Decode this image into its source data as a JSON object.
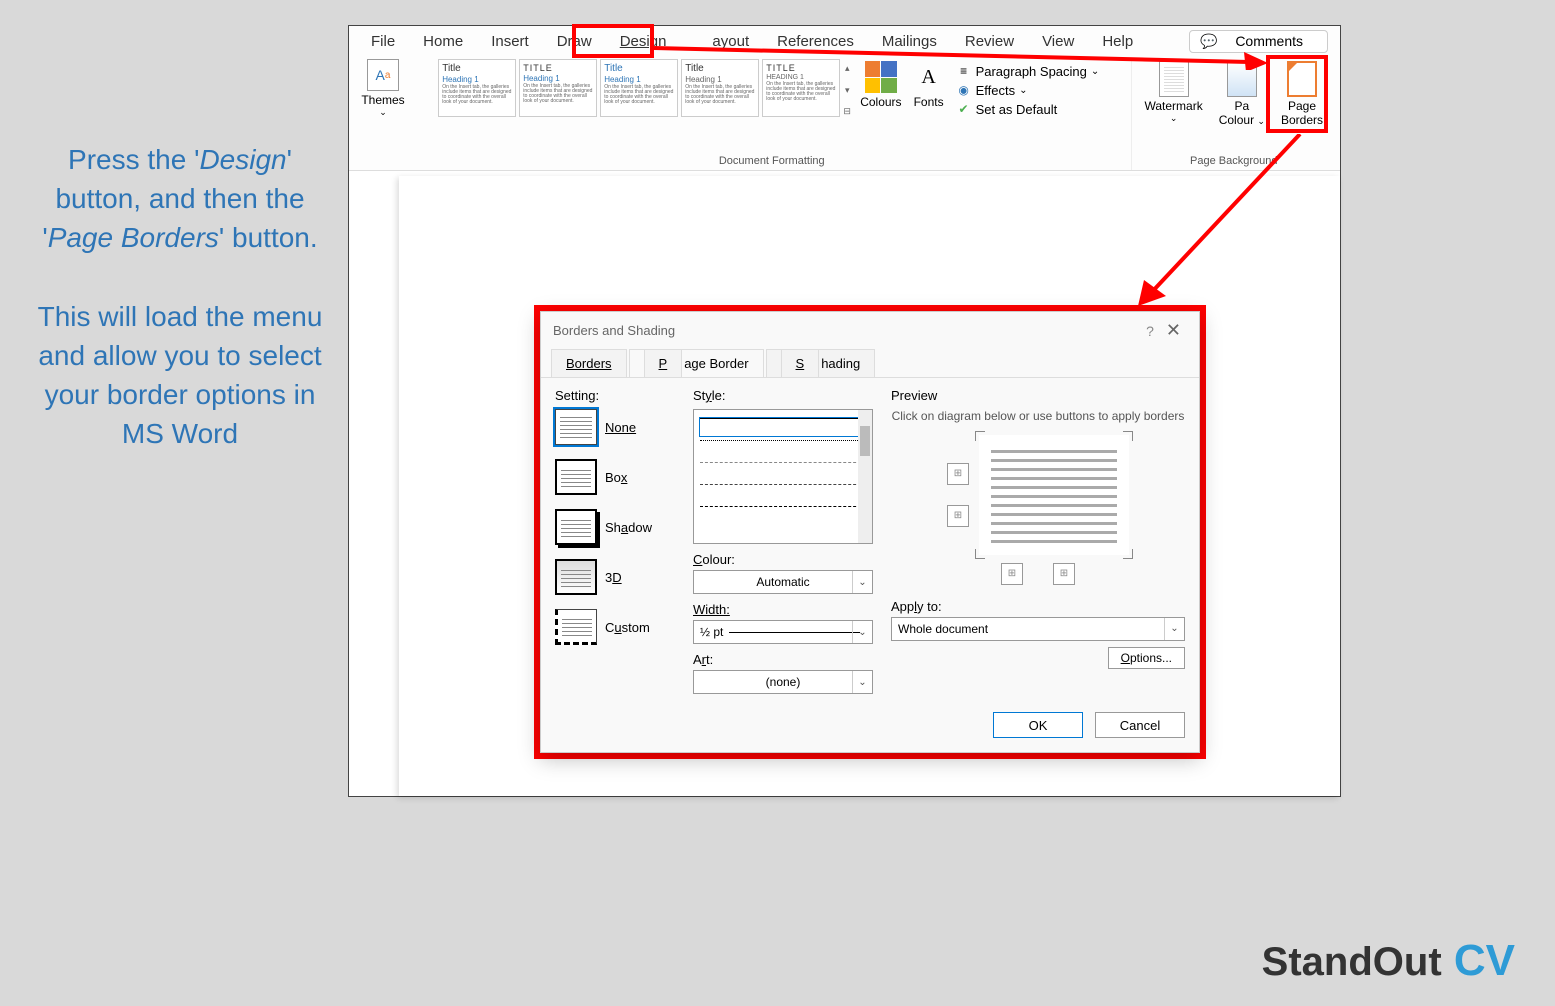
{
  "instruction": {
    "p1_prefix": "Press the '",
    "p1_em1": "Design",
    "p1_mid": "' button, and then the '",
    "p1_em2": "Page Borders",
    "p1_suffix": "' button.",
    "p2": "This will load the menu and allow you to select your border options in MS Word"
  },
  "ribbon": {
    "tabs": [
      "File",
      "Home",
      "Insert",
      "Draw",
      "Design",
      "ayout",
      "References",
      "Mailings",
      "Review",
      "View",
      "Help"
    ],
    "comments": "Comments",
    "themes": "Themes",
    "gallery_items": [
      {
        "title": "Title",
        "h": "Heading 1"
      },
      {
        "title": "TITLE",
        "h": "Heading 1"
      },
      {
        "title": "Title",
        "h": "Heading 1"
      },
      {
        "title": "Title",
        "h": "Heading 1"
      },
      {
        "title": "TITLE",
        "h": "HEADING 1"
      }
    ],
    "gallery_filler": "On the Insert tab, the galleries include items that are designed to coordinate with the overall look of your document.",
    "colours": "Colours",
    "fonts": "Fonts",
    "paragraph_spacing": "Paragraph Spacing",
    "effects": "Effects",
    "set_default": "Set as Default",
    "doc_formatting": "Document Formatting",
    "watermark": "Watermark",
    "page_colour_a": "Pa",
    "page_colour_b": "Colour",
    "page_borders": "Page Borders",
    "page_background": "Page Background"
  },
  "dialog": {
    "title": "Borders and Shading",
    "tab_borders": "Borders",
    "tab_page_border": "Page Border",
    "tab_shading": "Shading",
    "setting_label": "Setting:",
    "settings": {
      "none": "None",
      "box": "Box",
      "shadow": "Shadow",
      "threed": "3D",
      "custom": "Custom"
    },
    "style_label": "Style:",
    "colour_label": "Colour:",
    "colour_value": "Automatic",
    "width_label": "Width:",
    "width_value": "½ pt",
    "art_label": "Art:",
    "art_value": "(none)",
    "preview_label": "Preview",
    "preview_hint": "Click on diagram below or use buttons to apply borders",
    "apply_label": "Apply to:",
    "apply_value": "Whole document",
    "options": "Options...",
    "ok": "OK",
    "cancel": "Cancel"
  },
  "logo": {
    "a": "StandOut",
    "b": " CV"
  }
}
